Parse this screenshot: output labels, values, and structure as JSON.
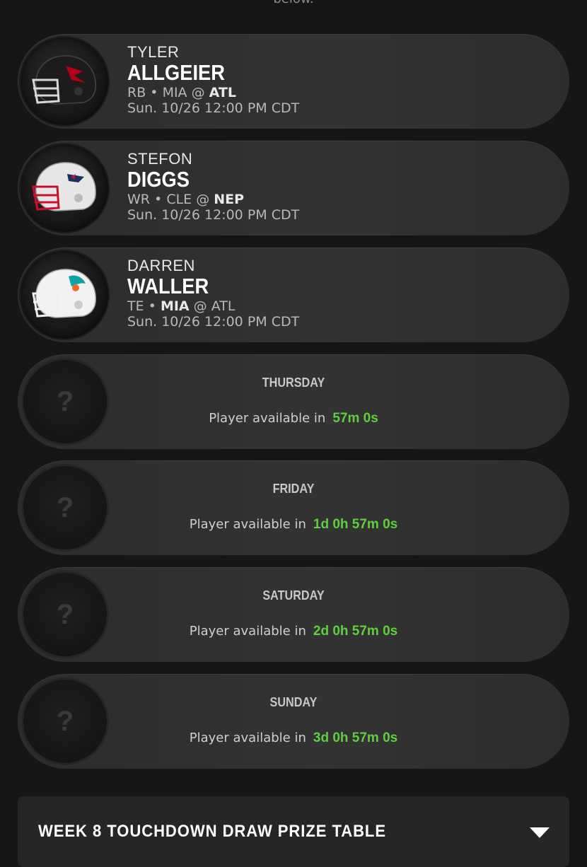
{
  "top_cut_text": "below.",
  "players": [
    {
      "first": "TYLER",
      "last": "ALLGEIER",
      "pos": "RB",
      "away": "MIA",
      "home": "ATL",
      "bold_team": "home",
      "time": "Sun. 10/26 12:00 PM CDT",
      "helmet_icon": "falcons-helmet-icon",
      "shell": "#1c1c1c",
      "accent": "#b3001b",
      "facemask": "#d9d9d9"
    },
    {
      "first": "STEFON",
      "last": "DIGGS",
      "pos": "WR",
      "away": "CLE",
      "home": "NEP",
      "bold_team": "home",
      "time": "Sun. 10/26 12:00 PM CDT",
      "helmet_icon": "patriots-helmet-icon",
      "shell": "#e6e6e6",
      "accent": "#1c2f5e",
      "facemask": "#c8102e"
    },
    {
      "first": "DARREN",
      "last": "WALLER",
      "pos": "TE",
      "away": "MIA",
      "home": "ATL",
      "bold_team": "away",
      "time": "Sun. 10/26 12:00 PM CDT",
      "helmet_icon": "dolphins-helmet-icon",
      "shell": "#f2f2f2",
      "accent": "#0aa3a8",
      "facemask": "#f0f0f0"
    }
  ],
  "separator": "•",
  "at": "@",
  "locked": [
    {
      "day": "THURSDAY",
      "label": "Player available in",
      "countdown": "57m 0s"
    },
    {
      "day": "FRIDAY",
      "label": "Player available in",
      "countdown": "1d 0h 57m 0s"
    },
    {
      "day": "SATURDAY",
      "label": "Player available in",
      "countdown": "2d 0h 57m 0s"
    },
    {
      "day": "SUNDAY",
      "label": "Player available in",
      "countdown": "3d 0h 57m 0s"
    }
  ],
  "locked_icon": "question-mark-icon",
  "prize_table": {
    "title": "WEEK 8 TOUCHDOWN DRAW PRIZE TABLE",
    "toggle_icon": "chevron-down-icon"
  },
  "colors": {
    "countdown": "#5fcf3e",
    "background": "#161616"
  }
}
